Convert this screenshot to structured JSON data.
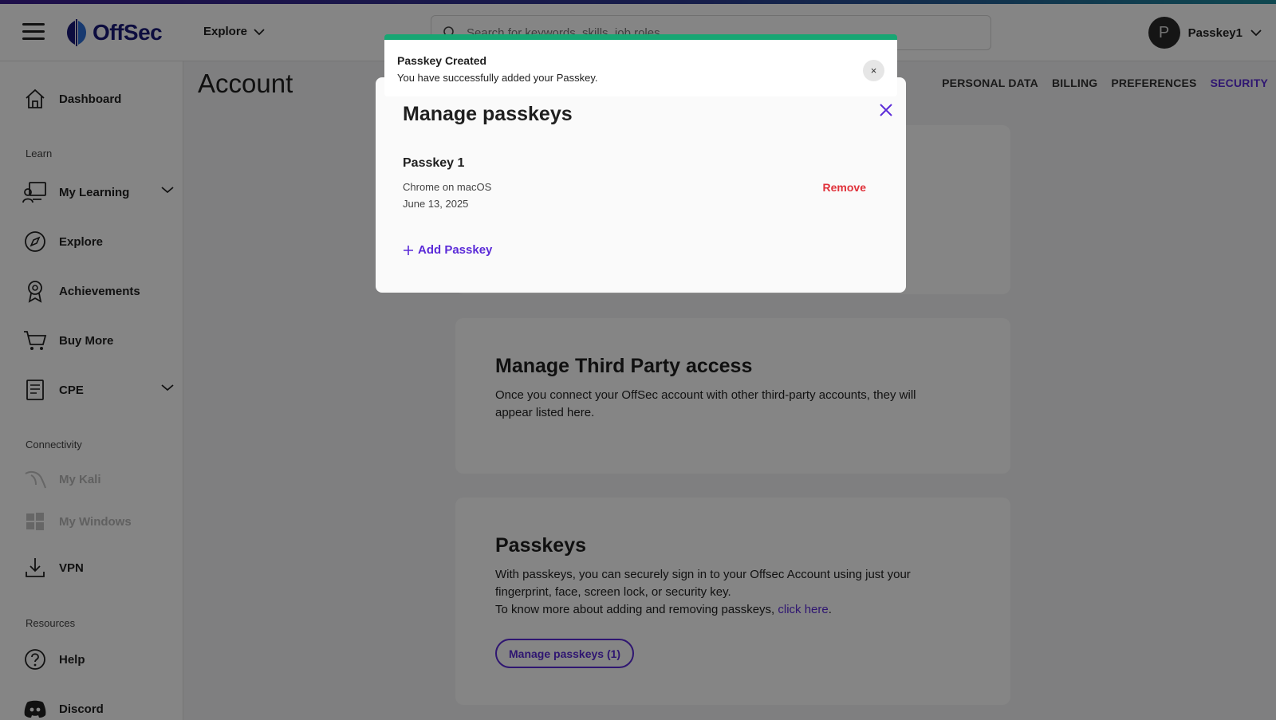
{
  "header": {
    "brand": "OffSec",
    "explore_label": "Explore",
    "search_placeholder": "Search for keywords, skills, job roles...",
    "user_initial": "P",
    "user_name": "Passkey1"
  },
  "sidebar": {
    "dashboard": "Dashboard",
    "learn_label": "Learn",
    "my_learning": "My Learning",
    "explore": "Explore",
    "achievements": "Achievements",
    "buy_more": "Buy More",
    "cpe": "CPE",
    "connectivity_label": "Connectivity",
    "my_kali": "My Kali",
    "my_windows": "My Windows",
    "vpn": "VPN",
    "resources_label": "Resources",
    "help": "Help",
    "discord": "Discord"
  },
  "main": {
    "title": "Account",
    "tabs": [
      "PERSONAL DATA",
      "BILLING",
      "PREFERENCES",
      "SECURITY"
    ],
    "third_party": {
      "title": "Manage Third Party access",
      "body": "Once you connect your OffSec account with other third-party accounts, they will appear listed here."
    },
    "passkeys": {
      "title": "Passkeys",
      "body_line1": "With passkeys, you can securely sign in to your Offsec Account using just your fingerprint, face, screen lock, or security key.",
      "body_line2_prefix": "To know more about adding and removing passkeys, ",
      "link_text": "click here",
      "body_line2_suffix": ".",
      "manage_button": "Manage passkeys (1)"
    }
  },
  "modal": {
    "title": "Manage passkeys",
    "passkey_name": "Passkey 1",
    "passkey_device": "Chrome on macOS",
    "passkey_date": "June 13, 2025",
    "remove_label": "Remove",
    "add_label": "Add Passkey"
  },
  "toast": {
    "title": "Passkey Created",
    "message": "You have successfully added your Passkey.",
    "close_glyph": "×"
  },
  "colors": {
    "accent": "#5b2bd8",
    "success": "#17a673",
    "danger": "#e0313a"
  }
}
